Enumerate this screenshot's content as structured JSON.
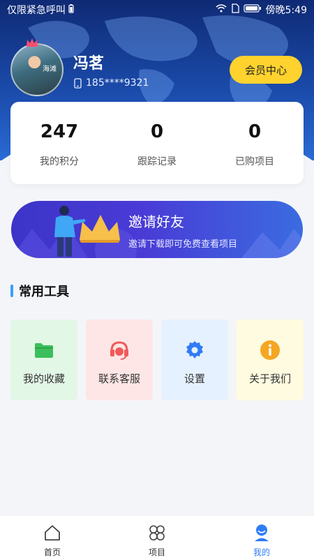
{
  "status_bar": {
    "left_text": "仅限紧急呼叫",
    "time": "傍晚5:49"
  },
  "profile": {
    "name": "冯茗",
    "phone": "185****9321",
    "vip_button": "会员中心",
    "avatar_caption": "海滩"
  },
  "stats": [
    {
      "value": "247",
      "label": "我的积分"
    },
    {
      "value": "0",
      "label": "跟踪记录"
    },
    {
      "value": "0",
      "label": "已购项目"
    }
  ],
  "invite": {
    "title": "邀请好友",
    "subtitle": "邀请下载即可免费查看项目"
  },
  "tools_section": {
    "title": "常用工具",
    "items": [
      {
        "label": "我的收藏",
        "icon": "folder-icon",
        "bg": "#e3f7e6",
        "color": "#3bbf5c"
      },
      {
        "label": "联系客服",
        "icon": "headset-icon",
        "bg": "#ffe6e6",
        "color": "#f05a5a"
      },
      {
        "label": "设置",
        "icon": "gear-icon",
        "bg": "#e6f1ff",
        "color": "#2f7cf6"
      },
      {
        "label": "关于我们",
        "icon": "info-icon",
        "bg": "#fffbe0",
        "color": "#f5a623"
      }
    ]
  },
  "bottom_nav": {
    "items": [
      {
        "label": "首页",
        "icon": "home-icon",
        "active": false
      },
      {
        "label": "项目",
        "icon": "grid-icon",
        "active": false
      },
      {
        "label": "我的",
        "icon": "profile-icon",
        "active": true
      }
    ]
  },
  "colors": {
    "header_dark": "#0f2a74",
    "accent_blue": "#2f7cf6",
    "vip_yellow": "#ffd22e",
    "section_bar": "#3aa0ff"
  }
}
